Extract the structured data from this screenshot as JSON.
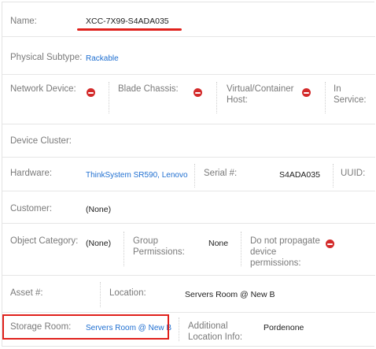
{
  "name": {
    "label": "Name:",
    "value": "XCC-7X99-S4ADA035"
  },
  "physical_subtype": {
    "label": "Physical Subtype:",
    "value": "Rackable"
  },
  "network_device": {
    "label": "Network Device:",
    "icon": "remove-icon"
  },
  "blade_chassis": {
    "label": "Blade Chassis:",
    "icon": "remove-icon"
  },
  "virtual_host": {
    "label_line1": "Virtual/Container",
    "label_line2": "Host:",
    "icon": "remove-icon"
  },
  "in_service": {
    "label": "In Service:"
  },
  "device_cluster": {
    "label": "Device Cluster:"
  },
  "hardware": {
    "label": "Hardware:",
    "value": "ThinkSystem SR590, Lenovo"
  },
  "serial": {
    "label": "Serial #:",
    "value": "S4ADA035"
  },
  "uuid": {
    "label": "UUID:"
  },
  "customer": {
    "label": "Customer:",
    "value": "(None)"
  },
  "object_category": {
    "label": "Object Category:",
    "value": "(None)"
  },
  "group_permissions": {
    "label_line1": "Group",
    "label_line2": "Permissions:",
    "value": "None"
  },
  "do_not_propagate": {
    "label_line1": "Do not propagate",
    "label_line2": "device",
    "label_line3": "permissions:",
    "icon": "remove-icon"
  },
  "asset": {
    "label": "Asset #:"
  },
  "location": {
    "label": "Location:",
    "value": "Servers Room @ New B"
  },
  "storage_room": {
    "label": "Storage Room:",
    "value": "Servers Room @ New B"
  },
  "additional_location": {
    "label_line1": "Additional",
    "label_line2": "Location Info:",
    "value": "Pordenone"
  },
  "colors": {
    "link": "#1f6fd1",
    "danger": "#d32a2a",
    "highlight": "#e0211c"
  }
}
